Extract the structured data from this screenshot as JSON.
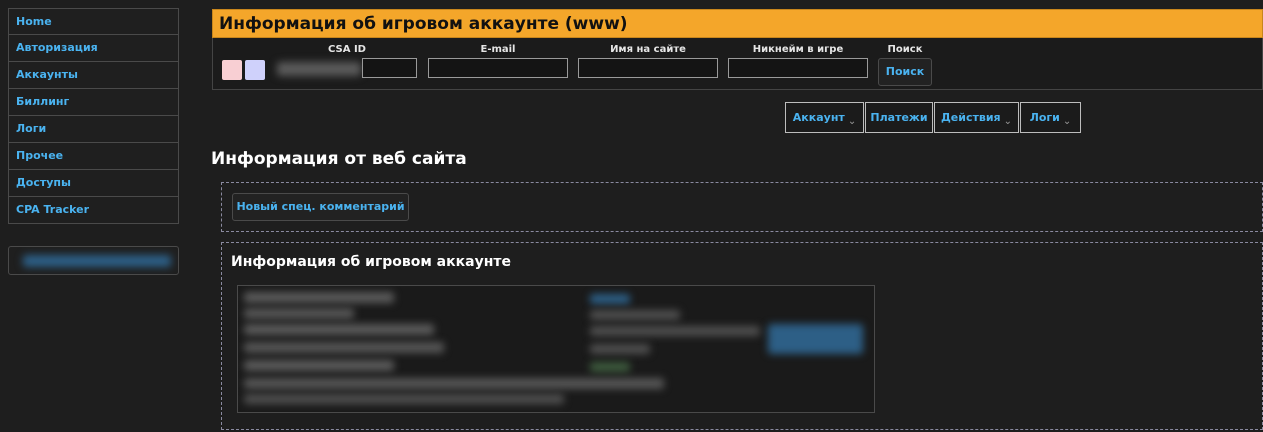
{
  "sidebar": {
    "items": [
      {
        "label": "Home"
      },
      {
        "label": "Авторизация"
      },
      {
        "label": "Аккаунты"
      },
      {
        "label": "Биллинг"
      },
      {
        "label": "Логи"
      },
      {
        "label": "Прочее"
      },
      {
        "label": "Доступы"
      },
      {
        "label": "CPA Tracker"
      }
    ]
  },
  "header": {
    "title": "Информация об игровом аккаунте (www)"
  },
  "search": {
    "fields": [
      {
        "label": "CSA ID",
        "value": ""
      },
      {
        "label": "E-mail",
        "value": ""
      },
      {
        "label": "Имя на сайте",
        "value": ""
      },
      {
        "label": "Никнейм в игре",
        "value": ""
      }
    ],
    "search_label": "Поиск",
    "search_button": "Поиск"
  },
  "menu": {
    "items": [
      {
        "label": "Аккаунт",
        "has_dropdown": true
      },
      {
        "label": "Платежи",
        "has_dropdown": false
      },
      {
        "label": "Действия",
        "has_dropdown": true
      },
      {
        "label": "Логи",
        "has_dropdown": true
      }
    ],
    "chevron": "⌄"
  },
  "main": {
    "web_section_title": "Информация от веб сайта",
    "new_comment_button": "Новый спец. комментарий",
    "game_section_title": "Информация об игровом аккаунте"
  },
  "colors": {
    "accent": "#4ab3f0",
    "header": "#f4a62a",
    "background": "#1e1e1e"
  }
}
